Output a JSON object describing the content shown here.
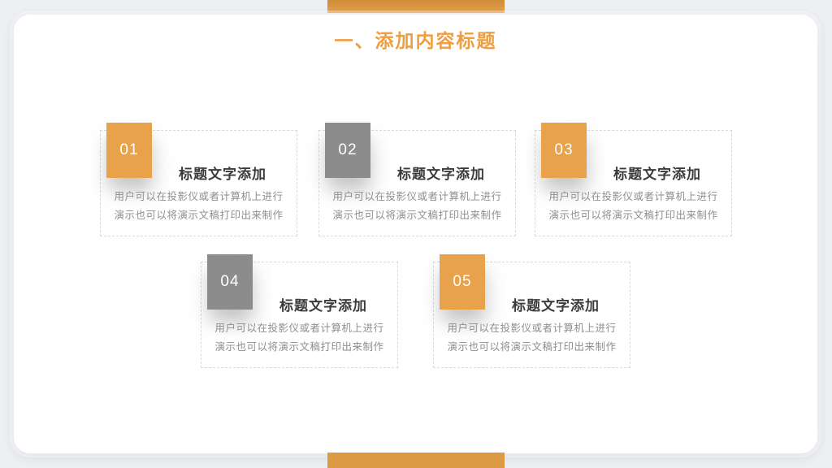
{
  "colors": {
    "accent": "#e8a24b",
    "gray": "#8c8c8c",
    "heading": "#ee9d3f",
    "title": "#3b3b3b",
    "desc": "#8e8e8e",
    "dash": "#d9d9d9",
    "page": "#edeff3",
    "slide": "#ffffff",
    "bar": "#dd9943",
    "bar_dark": "#cf8c36"
  },
  "slide": {
    "title": "一、添加内容标题",
    "cards": [
      {
        "number": "01",
        "variant": "orange",
        "title": "标题文字添加",
        "desc_line1": "用户可以在投影仪或者计算机上进行",
        "desc_line2": "演示也可以将演示文稿打印出来制作"
      },
      {
        "number": "02",
        "variant": "gray",
        "title": "标题文字添加",
        "desc_line1": "用户可以在投影仪或者计算机上进行",
        "desc_line2": "演示也可以将演示文稿打印出来制作"
      },
      {
        "number": "03",
        "variant": "orange",
        "title": "标题文字添加",
        "desc_line1": "用户可以在投影仪或者计算机上进行",
        "desc_line2": "演示也可以将演示文稿打印出来制作"
      },
      {
        "number": "04",
        "variant": "gray",
        "title": "标题文字添加",
        "desc_line1": "用户可以在投影仪或者计算机上进行",
        "desc_line2": "演示也可以将演示文稿打印出来制作"
      },
      {
        "number": "05",
        "variant": "orange",
        "title": "标题文字添加",
        "desc_line1": "用户可以在投影仪或者计算机上进行",
        "desc_line2": "演示也可以将演示文稿打印出来制作"
      }
    ]
  }
}
